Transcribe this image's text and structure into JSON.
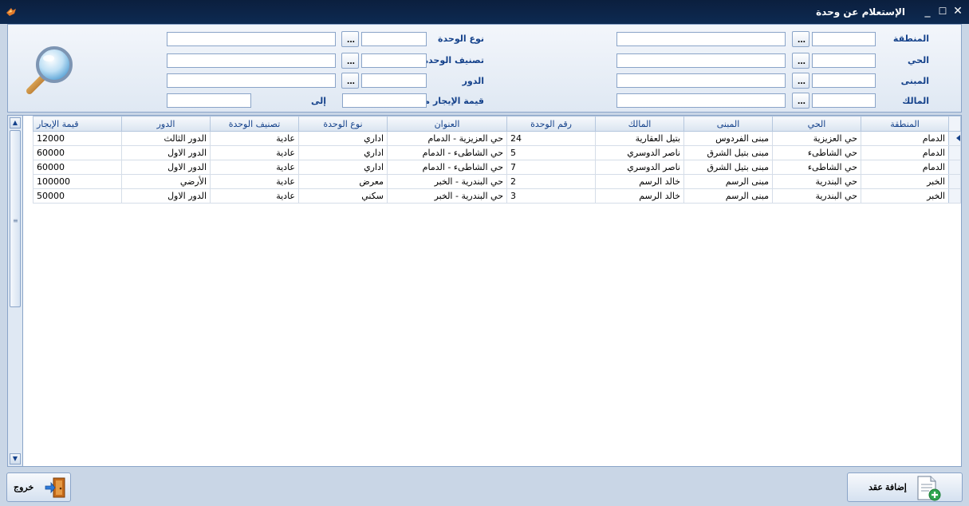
{
  "window": {
    "title": "الإستعلام عن وحدة",
    "minimize_glyph": "_",
    "maximize_glyph": "☐",
    "close_glyph": "✕"
  },
  "filters": {
    "region_label": "المنطقة",
    "district_label": "الحي",
    "building_label": "المبنى",
    "owner_label": "المالك",
    "unit_type_label": "نوع الوحدة",
    "unit_class_label": "تصنيف الوحدة",
    "floor_label": "الدور",
    "rent_from_label": "قيمة الإيجار من",
    "rent_to_label": "إلى",
    "lookup_button": "...",
    "values": {
      "region": "",
      "district": "",
      "building": "",
      "owner": "",
      "unit_type": "",
      "unit_class": "",
      "floor": "",
      "rent_from": "",
      "rent_to": ""
    }
  },
  "grid": {
    "columns": [
      "المنطقة",
      "الحي",
      "المبنى",
      "المالك",
      "رقم الوحدة",
      "العنوان",
      "نوع الوحدة",
      "تصنيف الوحدة",
      "الدور",
      "قيمة الإيجار"
    ],
    "rows": [
      [
        "الدمام",
        "حي العزيزية",
        "مبنى الفردوس",
        "بتيل العقارية",
        "24",
        "حي العزيزية - الدمام",
        "اداري",
        "عادية",
        "الدور الثالث",
        "12000"
      ],
      [
        "الدمام",
        "حي الشاطىء",
        "مبنى بتيل الشرق",
        "ناصر الدوسري",
        "5",
        "حي الشاطىء - الدمام",
        "اداري",
        "عادية",
        "الدور الاول",
        "60000"
      ],
      [
        "الدمام",
        "حي الشاطىء",
        "مبنى بتيل الشرق",
        "ناصر الدوسري",
        "7",
        "حي الشاطىء - الدمام",
        "اداري",
        "عادية",
        "الدور الاول",
        "60000"
      ],
      [
        "الخبر",
        "حي البندرية",
        "مبنى الرسم",
        "خالد الرسم",
        "2",
        "حي البندرية - الخبر",
        "معرض",
        "عادية",
        "الأرضي",
        "100000"
      ],
      [
        "الخبر",
        "حي البندرية",
        "مبنى الرسم",
        "خالد الرسم",
        "3",
        "حي البندرية - الخبر",
        "سكني",
        "عادية",
        "الدور الاول",
        "50000"
      ]
    ],
    "selected_row": 0
  },
  "buttons": {
    "add_contract": "إضافة عقد",
    "exit": "خروج"
  },
  "colors": {
    "titlebar": "#0b1f3e",
    "panel_border": "#8aa4c8",
    "label_text": "#15428b"
  }
}
